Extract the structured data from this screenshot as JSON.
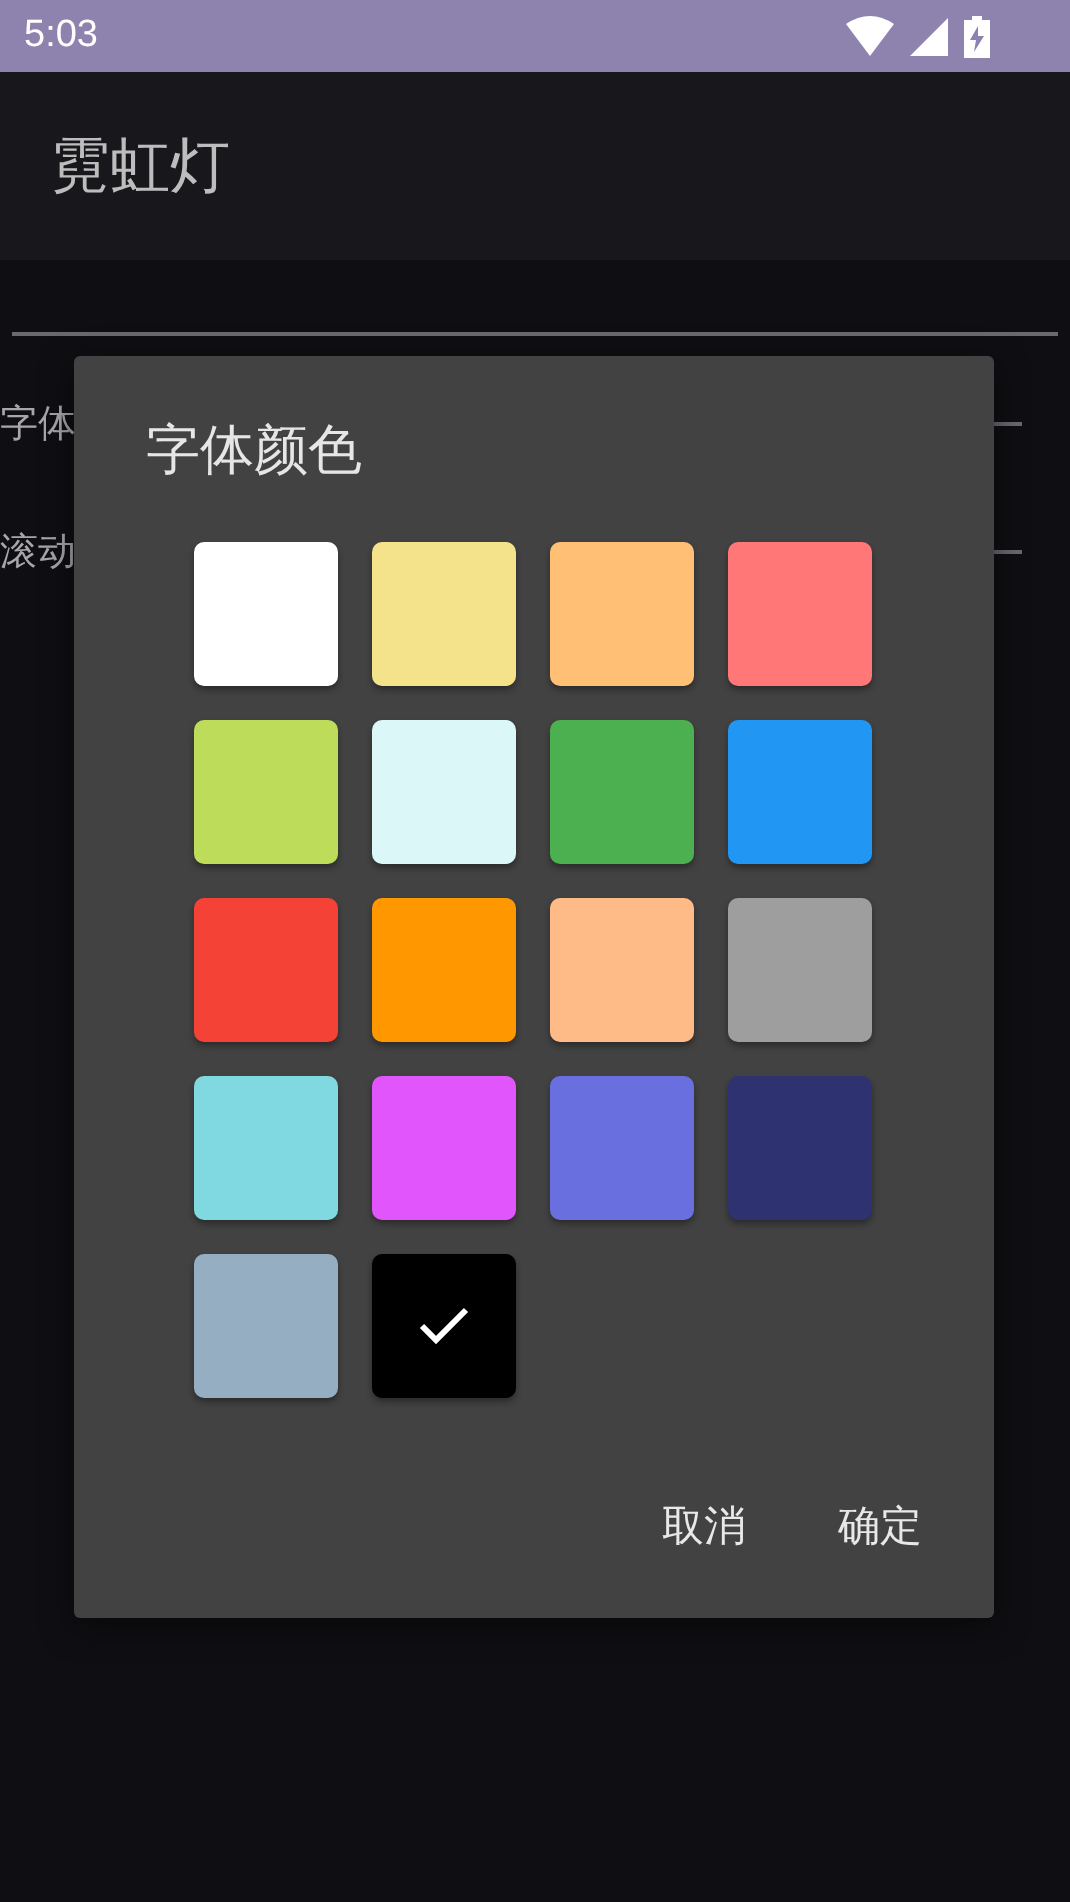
{
  "status_bar": {
    "time": "5:03"
  },
  "app_bar": {
    "title": "霓虹灯"
  },
  "content": {
    "settings": [
      {
        "label": "字体"
      },
      {
        "label": "滚动"
      }
    ]
  },
  "dialog": {
    "title": "字体颜色",
    "swatches": [
      {
        "color": "#ffffff",
        "selected": false
      },
      {
        "color": "#f5e38c",
        "selected": false
      },
      {
        "color": "#ffbf75",
        "selected": false
      },
      {
        "color": "#ff7777",
        "selected": false
      },
      {
        "color": "#bddc5a",
        "selected": false
      },
      {
        "color": "#dcf7f8",
        "selected": false
      },
      {
        "color": "#4caf50",
        "selected": false
      },
      {
        "color": "#2196f3",
        "selected": false
      },
      {
        "color": "#f44336",
        "selected": false
      },
      {
        "color": "#ff9800",
        "selected": false
      },
      {
        "color": "#ffbb87",
        "selected": false
      },
      {
        "color": "#9e9e9e",
        "selected": false
      },
      {
        "color": "#80d8e0",
        "selected": false
      },
      {
        "color": "#e055fc",
        "selected": false
      },
      {
        "color": "#6a6fe0",
        "selected": false
      },
      {
        "color": "#2e3270",
        "selected": false
      },
      {
        "color": "#96aec1",
        "selected": false
      },
      {
        "color": "#000000",
        "selected": true
      }
    ],
    "buttons": [
      "取消",
      "确定"
    ]
  }
}
